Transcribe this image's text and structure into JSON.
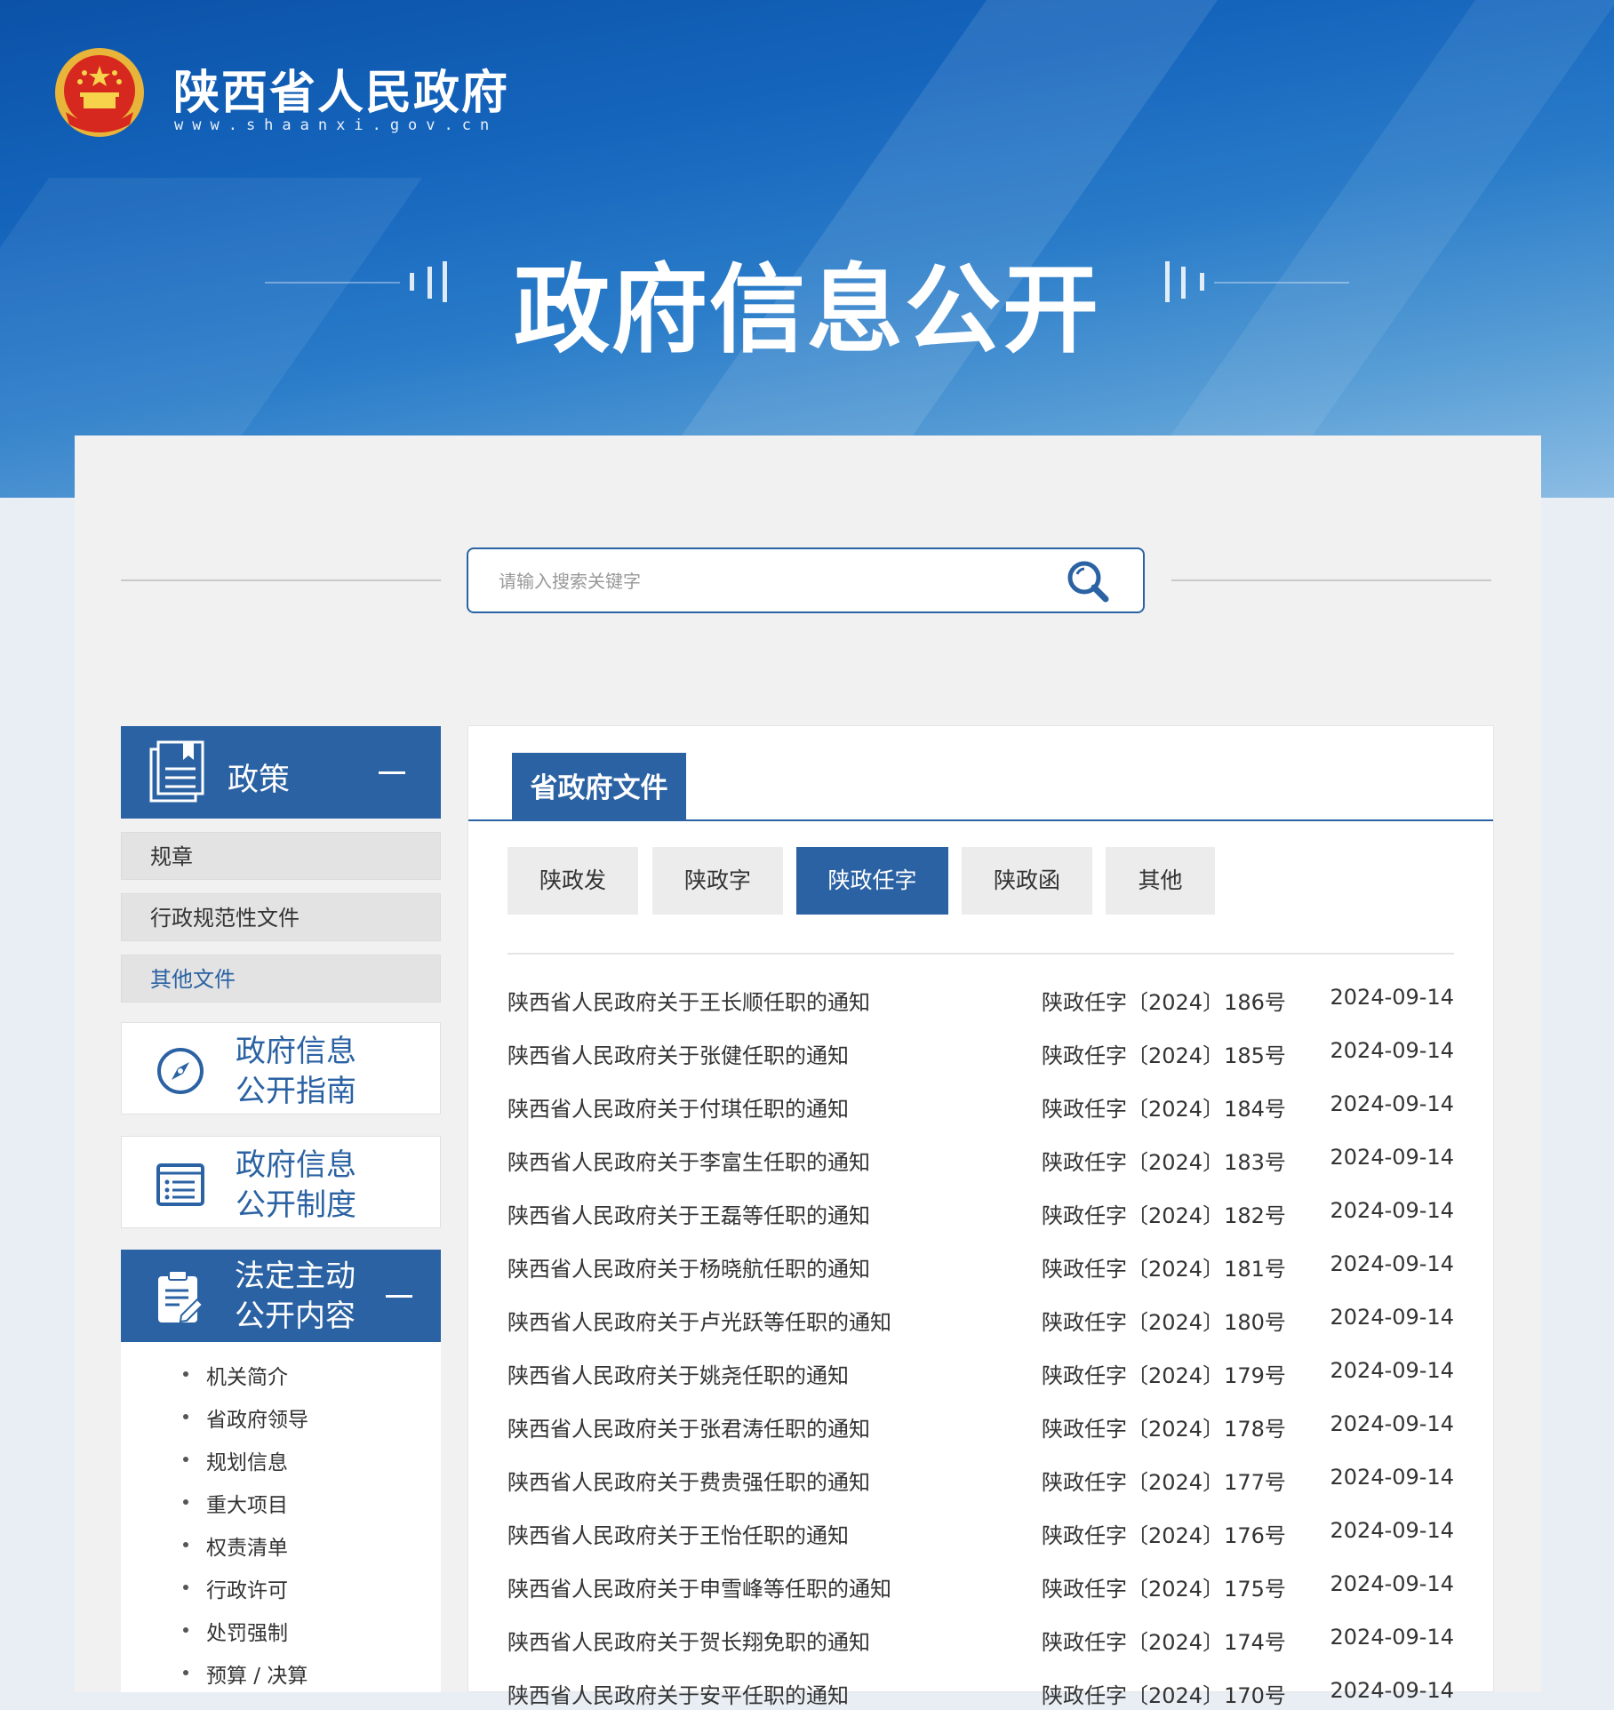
{
  "site": {
    "name": "陕西省人民政府",
    "url": "www.shaanxi.gov.cn"
  },
  "hero": {
    "title": "政府信息公开"
  },
  "search": {
    "placeholder": "请输入搜索关键字"
  },
  "sidebar": {
    "policy": {
      "label": "政策",
      "items": [
        {
          "label": "规章",
          "active": false
        },
        {
          "label": "行政规范性文件",
          "active": false
        },
        {
          "label": "其他文件",
          "active": true
        }
      ]
    },
    "guide": {
      "line1": "政府信息",
      "line2": "公开指南"
    },
    "system": {
      "line1": "政府信息",
      "line2": "公开制度"
    },
    "statutory": {
      "line1": "法定主动",
      "line2": "公开内容",
      "items": [
        "机关简介",
        "省政府领导",
        "规划信息",
        "重大项目",
        "权责清单",
        "行政许可",
        "处罚强制",
        "预算 / 决算"
      ]
    }
  },
  "content": {
    "tab": "省政府文件",
    "filters": [
      {
        "label": "陕政发",
        "active": false
      },
      {
        "label": "陕政字",
        "active": false
      },
      {
        "label": "陕政任字",
        "active": true
      },
      {
        "label": "陕政函",
        "active": false
      },
      {
        "label": "其他",
        "active": false
      }
    ],
    "rows": [
      {
        "title": "陕西省人民政府关于王长顺任职的通知",
        "number": "陕政任字〔2024〕186号",
        "date": "2024-09-14"
      },
      {
        "title": "陕西省人民政府关于张健任职的通知",
        "number": "陕政任字〔2024〕185号",
        "date": "2024-09-14"
      },
      {
        "title": "陕西省人民政府关于付琪任职的通知",
        "number": "陕政任字〔2024〕184号",
        "date": "2024-09-14"
      },
      {
        "title": "陕西省人民政府关于李富生任职的通知",
        "number": "陕政任字〔2024〕183号",
        "date": "2024-09-14"
      },
      {
        "title": "陕西省人民政府关于王磊等任职的通知",
        "number": "陕政任字〔2024〕182号",
        "date": "2024-09-14"
      },
      {
        "title": "陕西省人民政府关于杨晓航任职的通知",
        "number": "陕政任字〔2024〕181号",
        "date": "2024-09-14"
      },
      {
        "title": "陕西省人民政府关于卢光跃等任职的通知",
        "number": "陕政任字〔2024〕180号",
        "date": "2024-09-14"
      },
      {
        "title": "陕西省人民政府关于姚尧任职的通知",
        "number": "陕政任字〔2024〕179号",
        "date": "2024-09-14"
      },
      {
        "title": "陕西省人民政府关于张君涛任职的通知",
        "number": "陕政任字〔2024〕178号",
        "date": "2024-09-14"
      },
      {
        "title": "陕西省人民政府关于费贵强任职的通知",
        "number": "陕政任字〔2024〕177号",
        "date": "2024-09-14"
      },
      {
        "title": "陕西省人民政府关于王怡任职的通知",
        "number": "陕政任字〔2024〕176号",
        "date": "2024-09-14"
      },
      {
        "title": "陕西省人民政府关于申雪峰等任职的通知",
        "number": "陕政任字〔2024〕175号",
        "date": "2024-09-14"
      },
      {
        "title": "陕西省人民政府关于贺长翔免职的通知",
        "number": "陕政任字〔2024〕174号",
        "date": "2024-09-14"
      },
      {
        "title": "陕西省人民政府关于安平任职的通知",
        "number": "陕政任字〔2024〕170号",
        "date": "2024-09-14"
      }
    ]
  },
  "colors": {
    "brand_blue": "#2b62a3",
    "header_dark": "#0b52a8",
    "header_light": "#8cbde4"
  }
}
